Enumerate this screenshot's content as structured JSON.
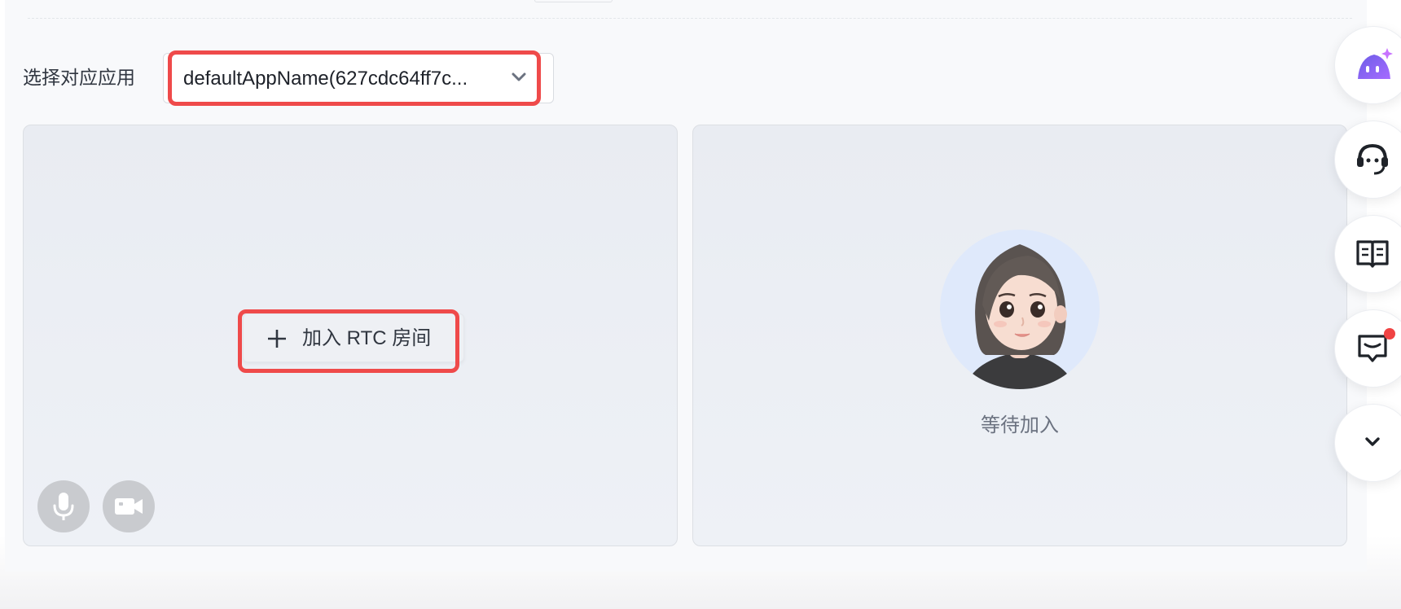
{
  "app_select": {
    "label": "选择对应应用",
    "value": "defaultAppName(627cdc64ff7c..."
  },
  "local_tile": {
    "join_button_label": "加入 RTC 房间",
    "mic_icon": "microphone-icon",
    "camera_icon": "video-camera-icon"
  },
  "remote_tile": {
    "status_label": "等待加入",
    "avatar_icon": "user-avatar"
  },
  "floating_toolbar": {
    "items": [
      {
        "icon": "ai-assistant-icon"
      },
      {
        "icon": "customer-service-headset-icon"
      },
      {
        "icon": "docs-book-icon"
      },
      {
        "icon": "feedback-message-icon",
        "has_notification": true
      },
      {
        "icon": "chevron-down-icon"
      }
    ]
  },
  "colors": {
    "highlight": "#ef4a4a",
    "notification": "#f04343",
    "ai_gradient_start": "#6c5ce7",
    "ai_gradient_end": "#a66cff"
  }
}
